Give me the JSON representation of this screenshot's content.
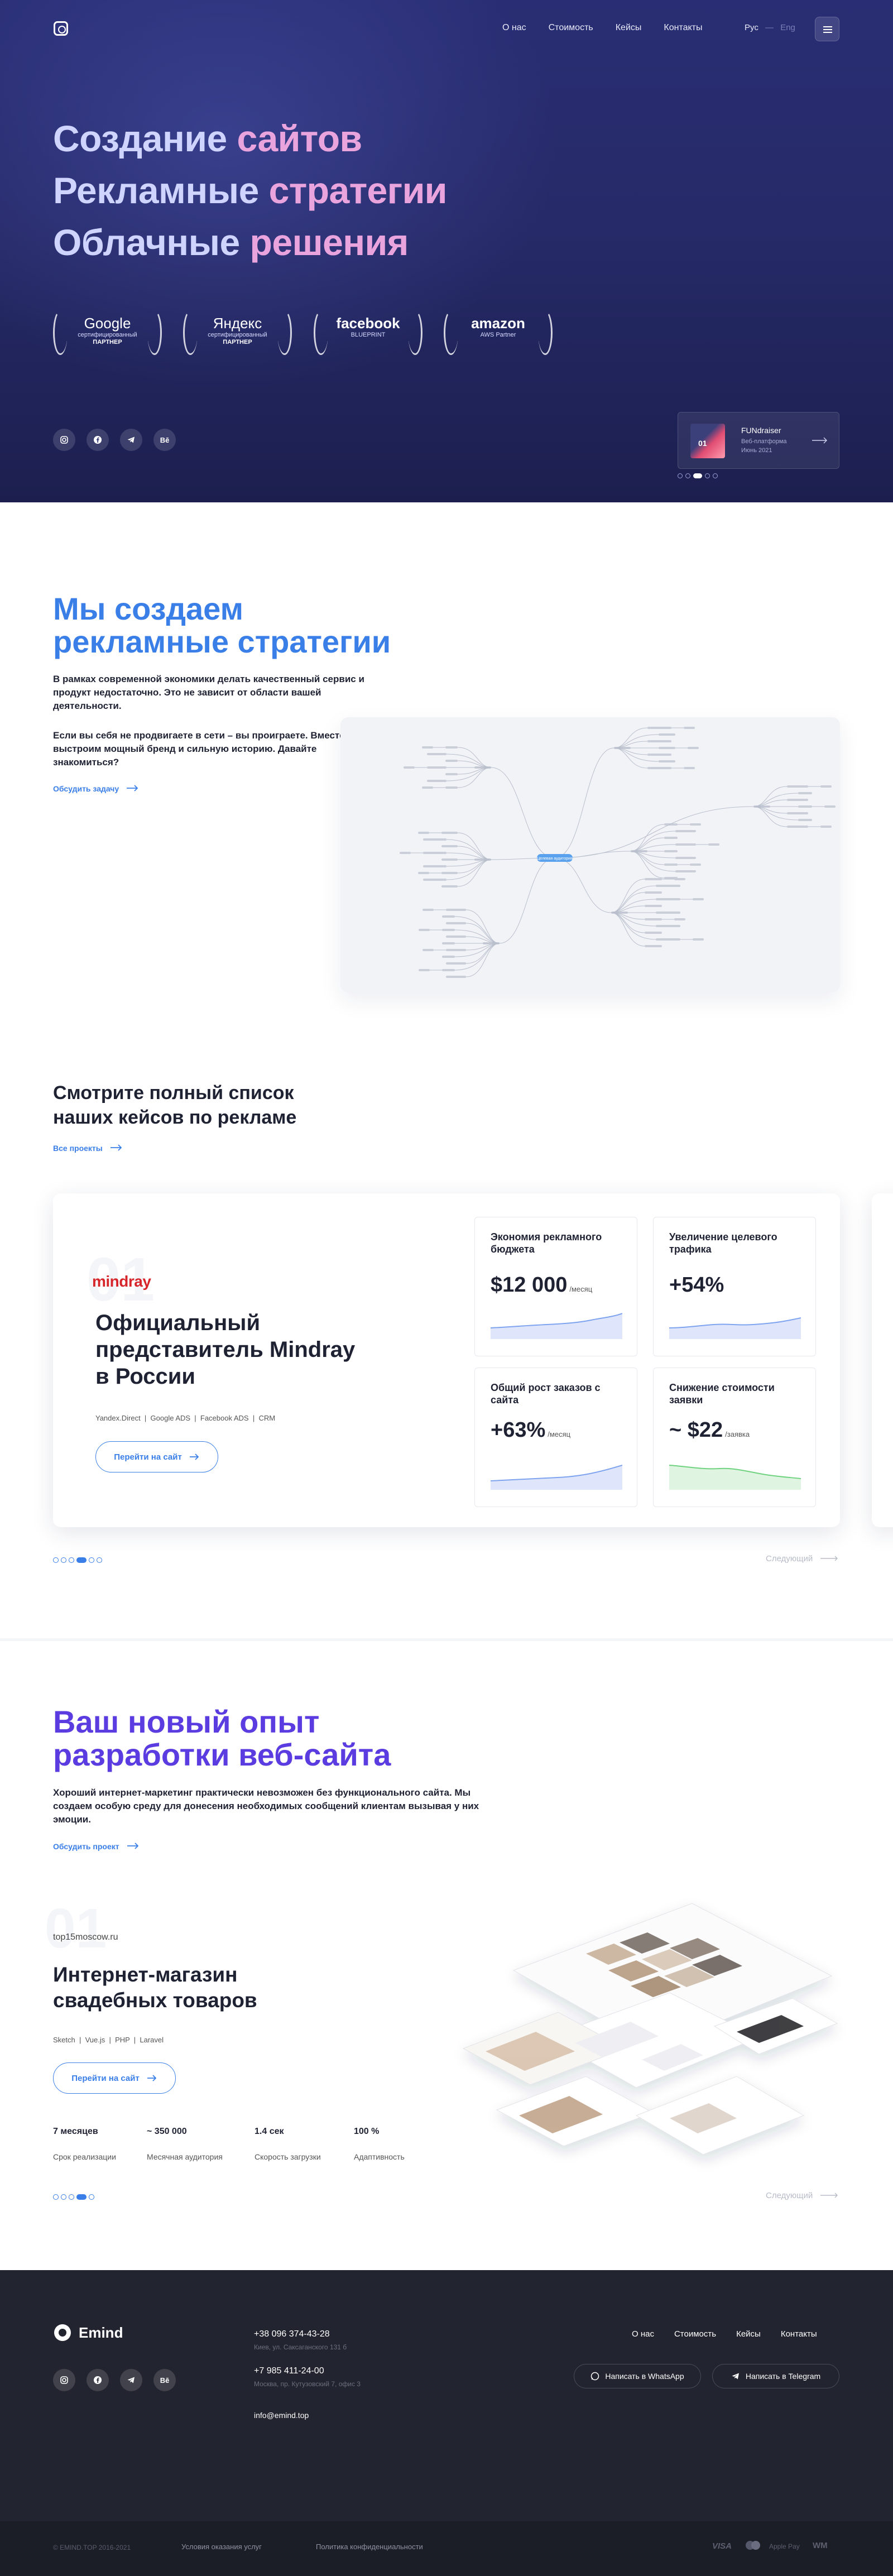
{
  "header": {
    "nav": [
      "О нас",
      "Стоимость",
      "Кейсы",
      "Контакты"
    ],
    "lang_active": "Рус",
    "lang_other": "Eng"
  },
  "hero": {
    "lines": [
      {
        "a": "Создание ",
        "b": "сайтов"
      },
      {
        "a": "Рекламные ",
        "b": "стратегии"
      },
      {
        "a": "Облачные ",
        "b": "решения"
      }
    ],
    "badges": [
      {
        "name": "Google",
        "sub": "сертифицированный",
        "sub2": "ПАРТНЕР"
      },
      {
        "name": "Яндекс",
        "sub": "сертифицированный",
        "sub2": "ПАРТНЕР"
      },
      {
        "name": "facebook",
        "sub": "BLUEPRINT",
        "sub2": ""
      },
      {
        "name": "amazon",
        "sub": "AWS Partner",
        "sub2": ""
      }
    ],
    "social": [
      "ig",
      "fb",
      "tg",
      "Be"
    ],
    "card": {
      "num": "01",
      "title": "FUNdraiser",
      "sub1": "Веб-платформа",
      "sub2": "Июнь 2021"
    },
    "slides_count": 5,
    "active_slide": 3
  },
  "strategy": {
    "title_l1": "Мы создаем",
    "title_l2": "рекламные стратегии",
    "p1": "В рамках современной экономики делать качественный сервис и продукт недостаточно. Это не зависит от области вашей деятельности.",
    "p2": "Если вы себя не продвигаете в сети – вы проиграете. Вместе мы выстроим мощный бренд и сильную историю. Давайте знакомиться?",
    "link": "Обсудить задачу",
    "map_center": "Целевая аудитория"
  },
  "cases": {
    "title_l1": "Смотрите полный список",
    "title_l2": "наших кейсов по рекламе",
    "link": "Все проекты",
    "card": {
      "num": "01",
      "brand": "mindray",
      "title_l1": "Официальный",
      "title_l2": "представитель Mindray",
      "title_l3": "в России",
      "tags": [
        "Yandex.Direct",
        "Google ADS",
        "Facebook ADS",
        "CRM"
      ],
      "button": "Перейти на сайт",
      "metrics": [
        {
          "title": "Экономия рекламного бюджета",
          "value": "$12 000",
          "unit": "/месяц",
          "color": "#3a7ee8"
        },
        {
          "title": "Увеличение целевого трафика",
          "value": "+54%",
          "unit": "",
          "color": "#3a7ee8"
        },
        {
          "title": "Общий рост заказов с сайта",
          "value": "+63%",
          "unit": "/месяц",
          "color": "#3a7ee8"
        },
        {
          "title": "Снижение стоимости заявки",
          "value": "~ $22",
          "unit": "/заявка",
          "color": "#4cc764"
        }
      ]
    },
    "next": "Следующий",
    "slides_count": 6,
    "active_slide": 4
  },
  "web": {
    "title_l1": "Ваш новый опыт",
    "title_l2": "разработки веб-сайта",
    "p": "Хороший интернет-маркетинг практически невозможен без функционального сайта. Мы создаем особую среду для донесения необходимых сообщений клиентам вызывая у них эмоции.",
    "link": "Обсудить проект",
    "project": {
      "num": "01",
      "domain": "top15moscow.ru",
      "title_l1": "Интернет-магазин",
      "title_l2": "свадебных товаров",
      "tags": [
        "Sketch",
        "Vue.js",
        "PHP",
        "Laravel"
      ],
      "button": "Перейти на сайт",
      "stats": [
        {
          "value": "7 месяцев",
          "label": "Срок реализации"
        },
        {
          "value": "~ 350 000",
          "label": "Месячная аудитория"
        },
        {
          "value": "1.4 сек",
          "label": "Скорость загрузки"
        },
        {
          "value": "100 %",
          "label": "Адаптивность"
        }
      ]
    },
    "next": "Следующий",
    "slides_count": 5,
    "active_slide": 4
  },
  "footer": {
    "brand": "Emind",
    "phone1": "+38 096 374-43-28",
    "addr1": "Киев, ул. Саксаганского 131 б",
    "phone2": "+7 985 411-24-00",
    "addr2": "Москва, пр. Кутузовский 7, офис 3",
    "email": "info@emind.top",
    "nav": [
      "О нас",
      "Стоимость",
      "Кейсы",
      "Контакты"
    ],
    "whatsapp": "Написать в WhatsApp",
    "telegram": "Написать в Telegram",
    "copyright": "© EMIND.TOP 2016-2021",
    "terms": "Условия оказания услуг",
    "privacy": "Политика конфиденциальности",
    "payments": [
      "VISA",
      "mastercard",
      "Apple Pay",
      "WM"
    ]
  }
}
